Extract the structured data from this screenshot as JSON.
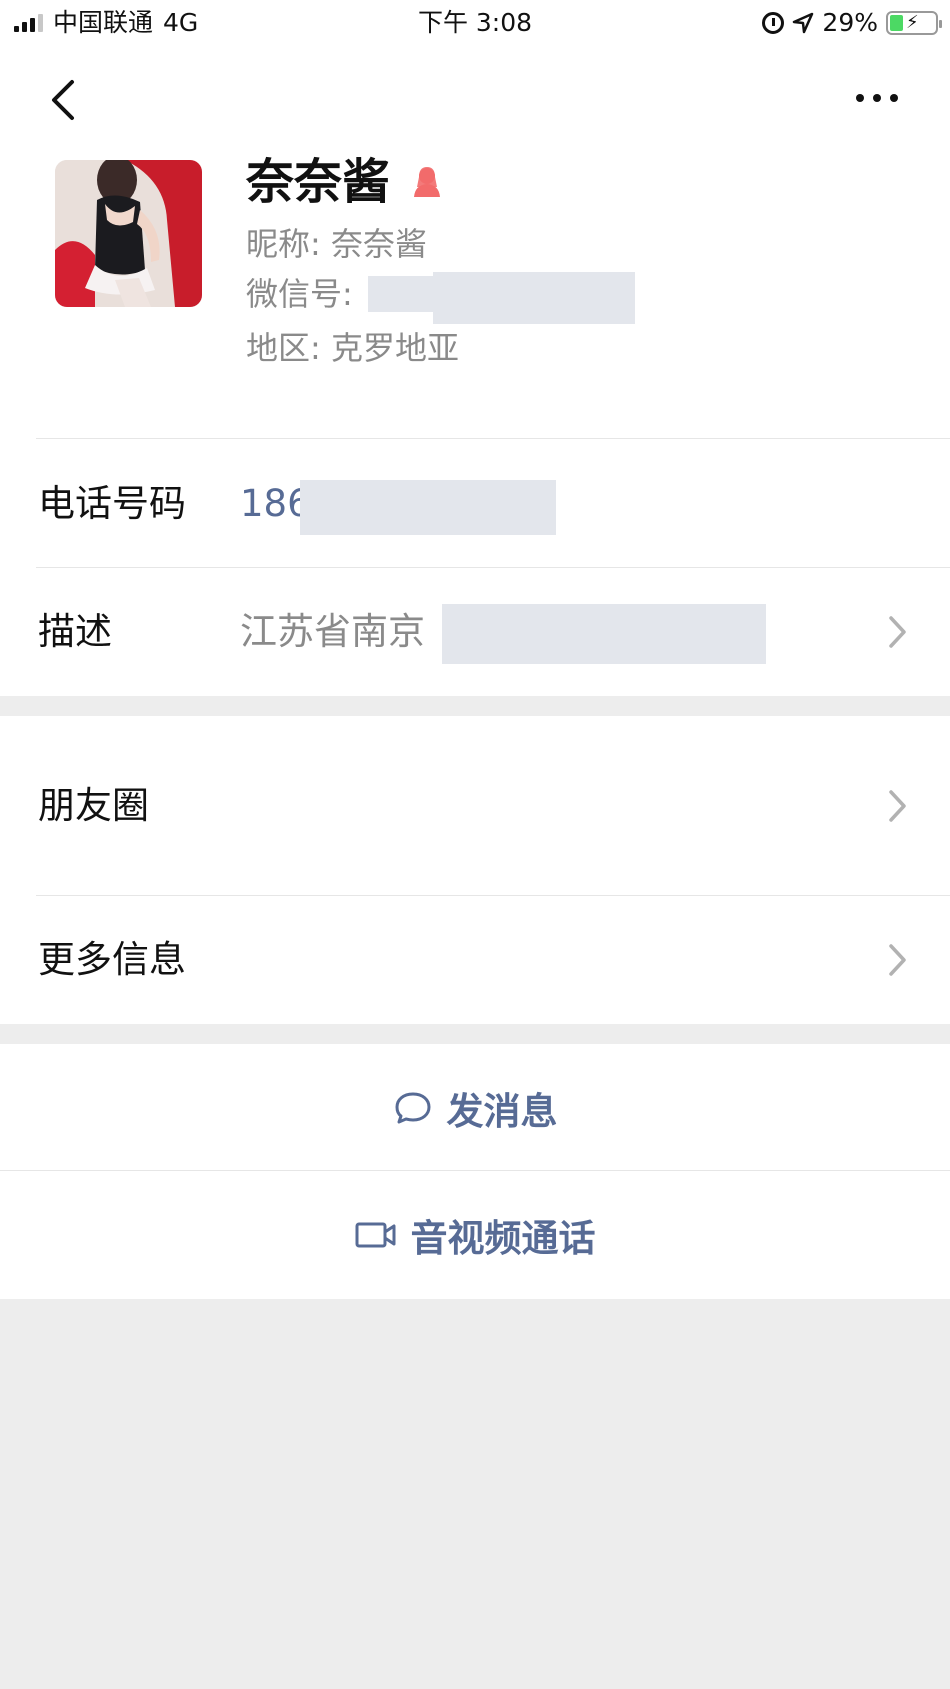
{
  "status_bar": {
    "carrier": "中国联通",
    "network": "4G",
    "time": "下午 3:08",
    "battery": "29%",
    "battery_level": 0.29
  },
  "nav": {
    "back_icon": "chevron-left-icon",
    "more_icon": "ellipsis-icon"
  },
  "profile": {
    "display_name": "奈奈酱",
    "gender_icon": "female-person-icon",
    "gender_color": "#fa5151",
    "nickname_label": "昵称:",
    "nickname": "奈奈酱",
    "wechat_id_label": "微信号:",
    "region_label": "地区:",
    "region": "克罗地亚"
  },
  "info": {
    "phone_label": "电话号码",
    "phone_value": "186",
    "description_label": "描述",
    "description_value": "江苏省南京"
  },
  "links": {
    "moments_label": "朋友圈",
    "more_info_label": "更多信息"
  },
  "actions": {
    "message_label": "发消息",
    "message_icon": "chat-bubble-icon",
    "call_label": "音视频通话",
    "call_icon": "video-camera-icon"
  },
  "colors": {
    "link_blue": "#576b95",
    "background": "#ededed",
    "redaction": "#e3e6ec"
  }
}
